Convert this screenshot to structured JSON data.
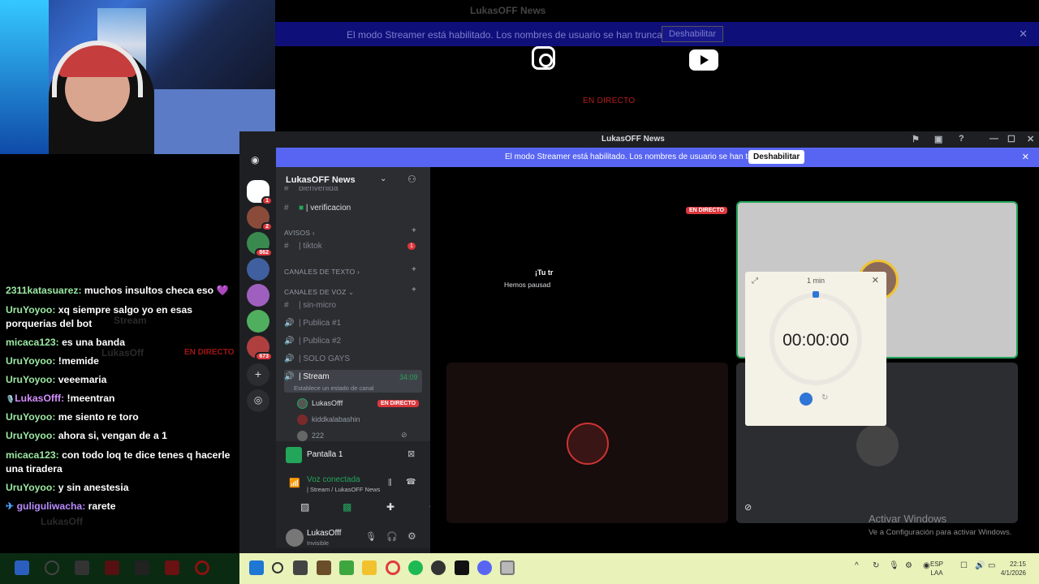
{
  "stream_overlay": {
    "top_title": "LukasOFF News",
    "streamer_banner_text": "El modo Streamer está habilitado. Los nombres de usuario se han truncado.",
    "streamer_banner_button": "Deshabilitar",
    "live_label": "EN DIRECTO"
  },
  "chat": {
    "messages": [
      {
        "user": "2311katasuarez:",
        "text": "muchos insultos checa eso 💜"
      },
      {
        "user": "UruYoyoo:",
        "text": "xq siempre salgo yo en esas porquerias del bot"
      },
      {
        "user": "micaca123:",
        "text": "es una banda"
      },
      {
        "user": "UruYoyoo:",
        "text": "!memide"
      },
      {
        "user": "UruYoyoo:",
        "text": "veeemaria"
      },
      {
        "user": "LukasOfff:",
        "text": "!meentran",
        "badge": "🎙️"
      },
      {
        "user": "UruYoyoo:",
        "text": "me siento re toro"
      },
      {
        "user": "UruYoyoo:",
        "text": "ahora si, vengan de a 1"
      },
      {
        "user": "micaca123:",
        "text": "con todo loq te dice tenes q hacerle una tiradera"
      },
      {
        "user": "UruYoyoo:",
        "text": "y sin anestesia"
      },
      {
        "user": "guliguliwacha:",
        "text": "rarete",
        "badge": "✈"
      }
    ],
    "ghost_texts": [
      "Stream",
      "LukasOff",
      "EN DIRECTO",
      "LukasOff"
    ]
  },
  "discord": {
    "window_title": "LukasOFF News",
    "banner_text": "El modo Streamer está habilitado. Los nombres de usuario se han truncado.",
    "banner_button": "Deshabilitar",
    "server_name": "LukasOFF News",
    "server_badges": [
      "1",
      "2",
      "862",
      "673"
    ],
    "channels": {
      "partial_top": "bienvenida",
      "verification": "verificacion",
      "cat_avisos": "AVISOS",
      "tiktok": "tiktok",
      "tiktok_badge": "1",
      "cat_text": "CANALES DE TEXTO",
      "cat_voice": "CANALES DE VOZ",
      "sin_micro": "sin-micro",
      "publica1": "Publica #1",
      "publica2": "Publica #2",
      "solo_gays": "SOLO GAYS",
      "stream": "Stream",
      "stream_time": "34:09",
      "stream_status": "Establece un estado de canal"
    },
    "voice_users": [
      {
        "name": "LukasOfff",
        "live": "EN DIRECTO"
      },
      {
        "name": "kiddkalabashin"
      },
      {
        "name": "222"
      }
    ],
    "screen_share": "Pantalla 1",
    "voice_connected": "Voz conectada",
    "voice_channel_path": "| Stream / LukasOFF News",
    "user_name": "LukasOfff",
    "user_status": "Invisible",
    "live_label": "EN DIRECTO",
    "stage_text_1": "¡Tu tr",
    "stage_text_2": "Hemos pausad"
  },
  "timer": {
    "label": "1 min",
    "time": "00:00:00"
  },
  "activate_windows": {
    "line1": "Activar Windows",
    "line2": "Ve a Configuración para activar Windows."
  },
  "taskbar": {
    "lang1": "ESP",
    "lang2": "LAA",
    "time": "22:15",
    "date": "4/1/2026"
  },
  "colors": {
    "discord_bg": "#1e1f22",
    "discord_blurple": "#5865f2",
    "live_red": "#da373c",
    "voice_green": "#23a55a",
    "taskbar_bg": "#e9f2b9"
  }
}
